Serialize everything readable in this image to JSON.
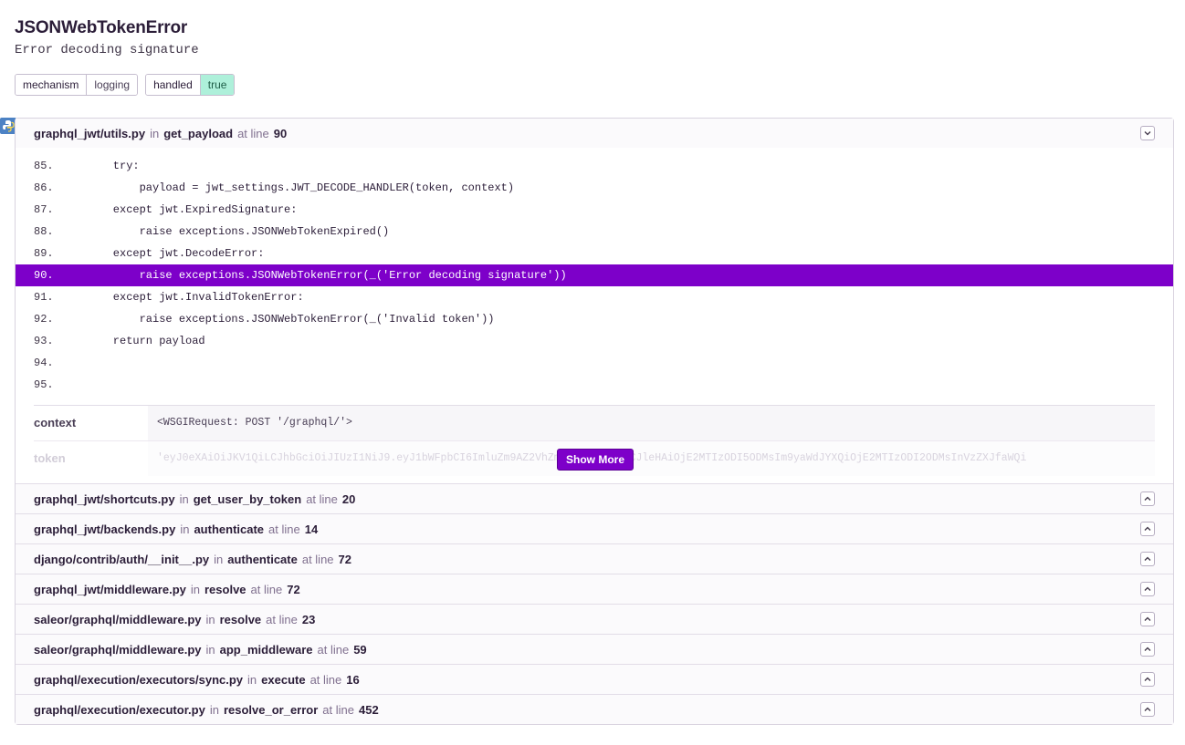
{
  "error": {
    "type": "JSONWebTokenError",
    "value": "Error decoding signature"
  },
  "tags": [
    {
      "key": "mechanism",
      "value": "logging"
    },
    {
      "key": "handled",
      "value": "true"
    }
  ],
  "labels": {
    "in": "in",
    "at_line": "at line"
  },
  "platform_icon": "python-icon",
  "expanded_frame": {
    "file": "graphql_jwt/utils.py",
    "function": "get_payload",
    "line": "90",
    "code": [
      {
        "n": "85.",
        "src": "    try:"
      },
      {
        "n": "86.",
        "src": "        payload = jwt_settings.JWT_DECODE_HANDLER(token, context)"
      },
      {
        "n": "87.",
        "src": "    except jwt.ExpiredSignature:"
      },
      {
        "n": "88.",
        "src": "        raise exceptions.JSONWebTokenExpired()"
      },
      {
        "n": "89.",
        "src": "    except jwt.DecodeError:"
      },
      {
        "n": "90.",
        "src": "        raise exceptions.JSONWebTokenError(_('Error decoding signature'))"
      },
      {
        "n": "91.",
        "src": "    except jwt.InvalidTokenError:"
      },
      {
        "n": "92.",
        "src": "        raise exceptions.JSONWebTokenError(_('Invalid token'))"
      },
      {
        "n": "93.",
        "src": "    return payload"
      },
      {
        "n": "94.",
        "src": ""
      },
      {
        "n": "95.",
        "src": ""
      }
    ],
    "vars": [
      {
        "key": "context",
        "value": "<WSGIRequest: POST '/graphql/'>"
      },
      {
        "key": "token",
        "value": "'eyJ0eXAiOiJKV1QiLCJhbGciOiJIUzI1NiJ9.eyJ1bWFpbCI6ImluZm9AZ2VhZm9vZC5jb20iLCJleHAiOjE2MTIzODI5ODMsIm9yaWdJYXQiOjE2MTIzODI2ODMsInVzZXJfaWQi"
      }
    ],
    "show_more_label": "Show More"
  },
  "frames": [
    {
      "file": "graphql_jwt/shortcuts.py",
      "function": "get_user_by_token",
      "line": "20"
    },
    {
      "file": "graphql_jwt/backends.py",
      "function": "authenticate",
      "line": "14"
    },
    {
      "file": "django/contrib/auth/__init__.py",
      "function": "authenticate",
      "line": "72"
    },
    {
      "file": "graphql_jwt/middleware.py",
      "function": "resolve",
      "line": "72"
    },
    {
      "file": "saleor/graphql/middleware.py",
      "function": "resolve",
      "line": "23"
    },
    {
      "file": "saleor/graphql/middleware.py",
      "function": "app_middleware",
      "line": "59"
    },
    {
      "file": "graphql/execution/executors/sync.py",
      "function": "execute",
      "line": "16"
    },
    {
      "file": "graphql/execution/executor.py",
      "function": "resolve_or_error",
      "line": "452"
    }
  ]
}
